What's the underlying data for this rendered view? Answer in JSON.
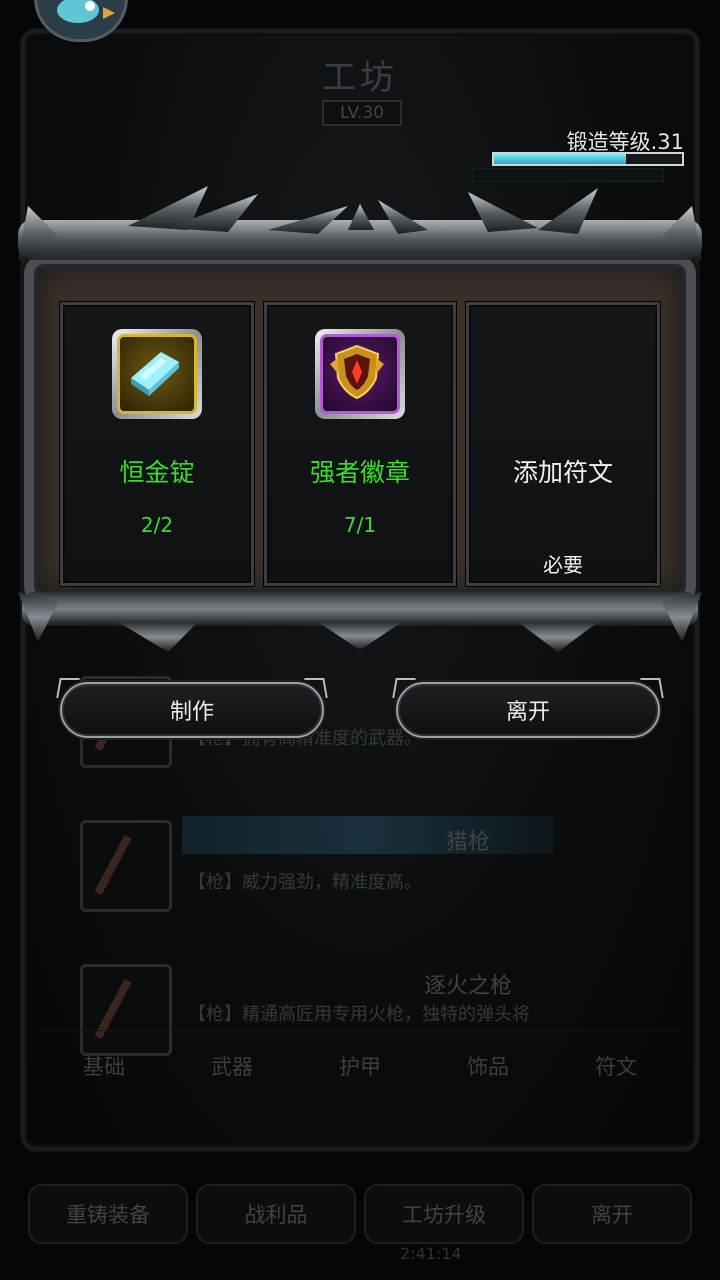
{
  "background": {
    "title": "工坊",
    "level": "LV.30",
    "forge_level_label": "锻造等级.31",
    "forge_progress": 0.7,
    "items": [
      {
        "name": "",
        "desc": "【枪】拥有高精准度的武器。"
      },
      {
        "name": "猎枪",
        "desc": "【枪】威力强劲，精准度高。"
      },
      {
        "name": "逐火之枪",
        "desc": "【枪】精通高匠用专用火枪，独特的弹头将"
      }
    ],
    "tabs": [
      "基础",
      "武器",
      "护甲",
      "饰品",
      "符文"
    ],
    "active_tab": "武器",
    "bottom_buttons": [
      "重铸装备",
      "战利品",
      "工坊升级",
      "离开"
    ],
    "time": "2:41:14"
  },
  "crafting": {
    "materials": [
      {
        "name": "恒金锭",
        "count": "2/2",
        "icon": "ingot-icon",
        "rarity_color": "#d8b62b",
        "name_color": "#3cdc2c"
      },
      {
        "name": "强者徽章",
        "count": "7/1",
        "icon": "badge-icon",
        "rarity_color": "#b45ad7",
        "name_color": "#3cdc2c"
      }
    ],
    "rune_slot": {
      "label": "添加符文",
      "required": "必要"
    }
  },
  "actions": {
    "make_label": "制作",
    "leave_label": "离开"
  }
}
